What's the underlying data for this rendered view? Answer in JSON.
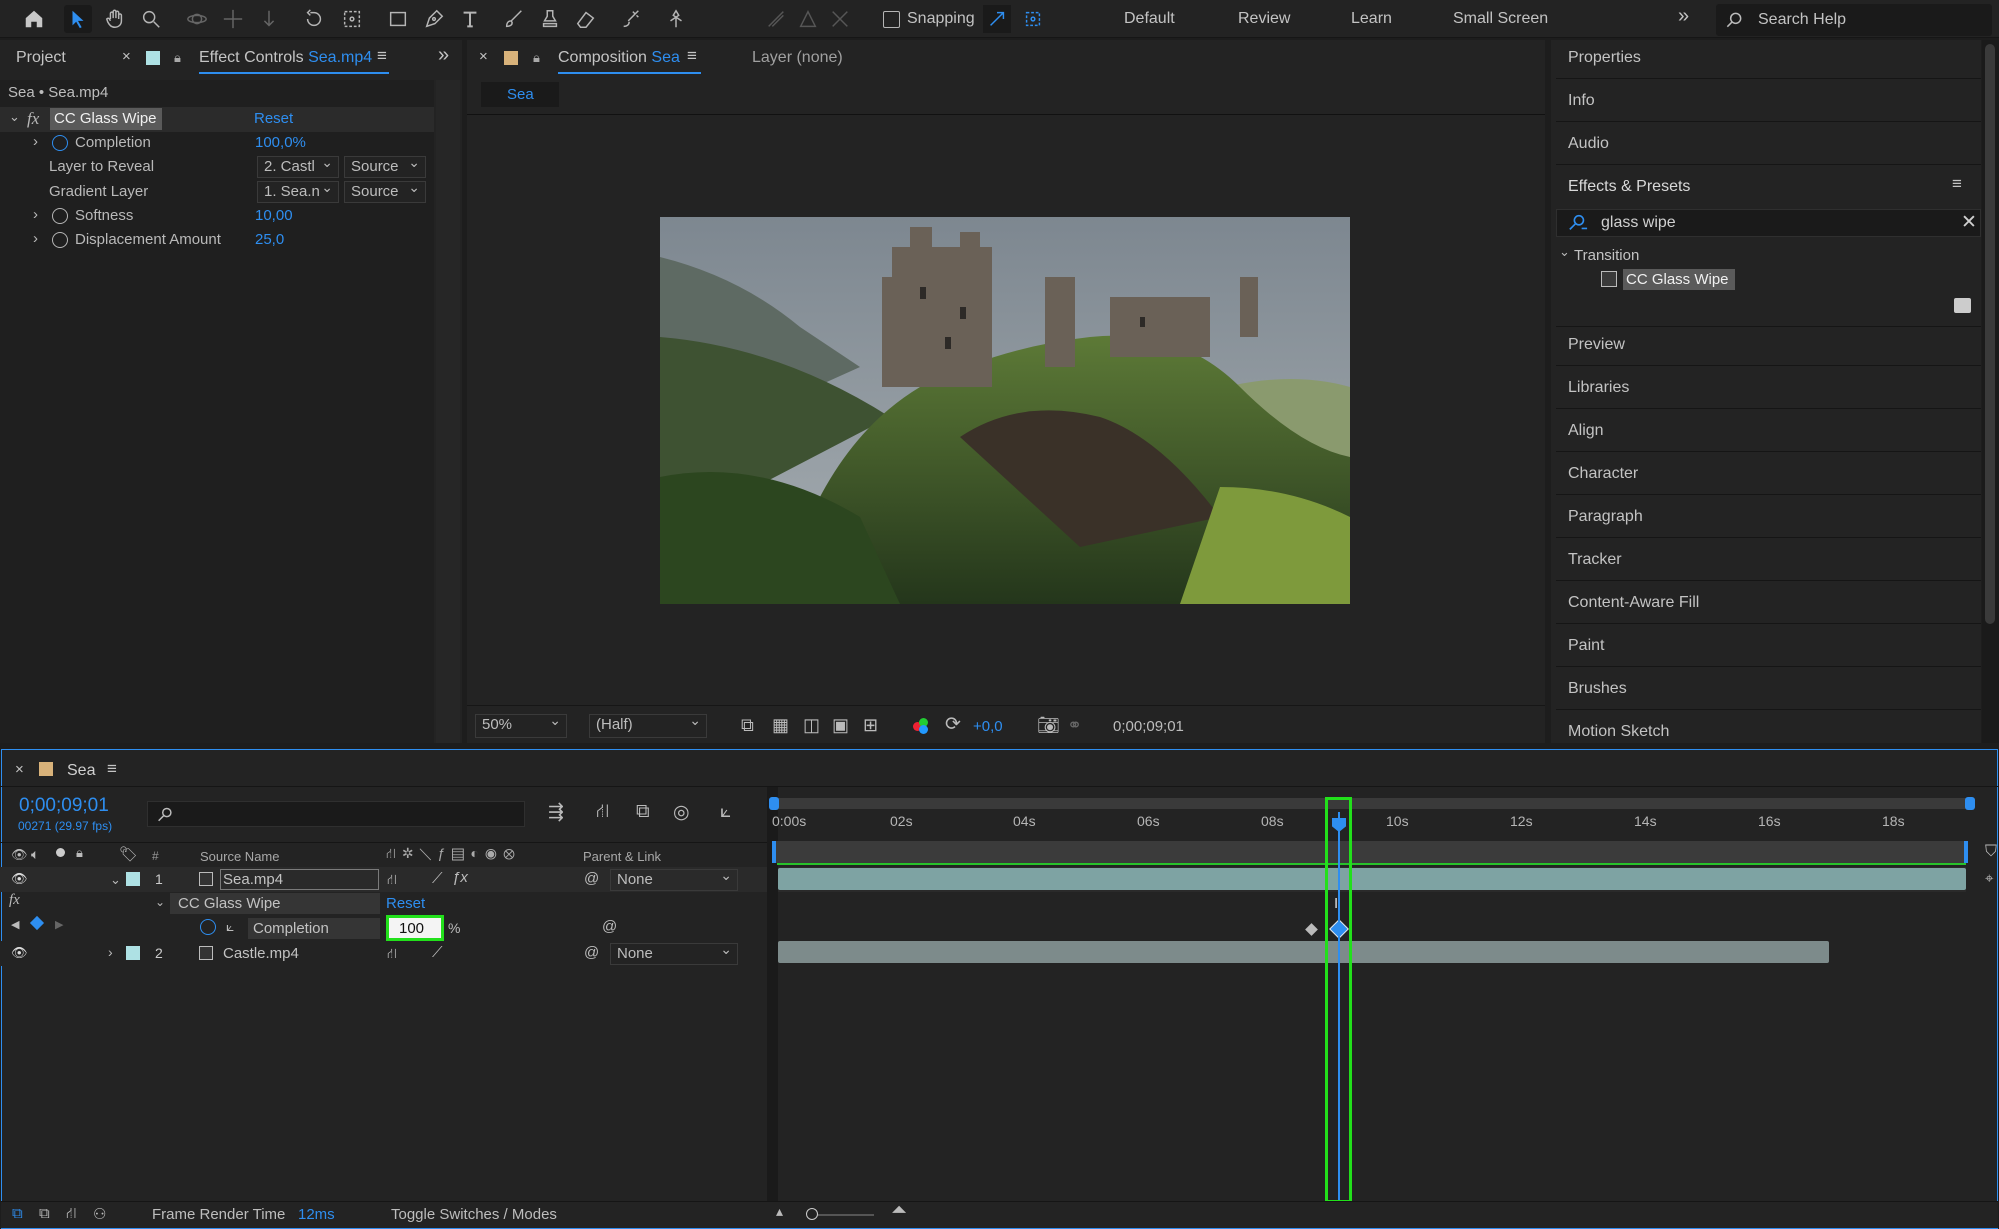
{
  "toolbar": {
    "snapping_label": "Snapping",
    "workspaces": [
      "Default",
      "Review",
      "Learn",
      "Small Screen"
    ],
    "search_help_placeholder": "Search Help"
  },
  "left_panel": {
    "tab_project": "Project",
    "tab_effect_controls": "Effect Controls",
    "tab_effect_controls_layer": "Sea.mp4",
    "context": "Sea • Sea.mp4",
    "effect_name": "CC Glass Wipe",
    "effect_reset": "Reset",
    "properties": [
      {
        "label": "Completion",
        "value": "100,0%"
      },
      {
        "label": "Layer to Reveal",
        "value": "2. Castl",
        "source": "Source"
      },
      {
        "label": "Gradient Layer",
        "value": "1. Sea.n",
        "source": "Source"
      },
      {
        "label": "Softness",
        "value": "10,00"
      },
      {
        "label": "Displacement Amount",
        "value": "25,0"
      }
    ]
  },
  "comp_panel": {
    "tab_label": "Composition",
    "tab_comp": "Sea",
    "layer_tab": "Layer (none)",
    "subtab": "Sea",
    "zoom": "50%",
    "resolution": "(Half)",
    "exposure": "+0,0",
    "timecode": "0;00;09;01"
  },
  "right_panel": {
    "items_top": [
      "Properties",
      "Info",
      "Audio"
    ],
    "effects_title": "Effects & Presets",
    "search_value": "glass wipe",
    "folder": "Transition",
    "result": "CC Glass Wipe",
    "items_bottom": [
      "Preview",
      "Libraries",
      "Align",
      "Character",
      "Paragraph",
      "Tracker",
      "Content-Aware Fill",
      "Paint",
      "Brushes",
      "Motion Sketch"
    ]
  },
  "timeline": {
    "comp_name": "Sea",
    "current_time": "0;00;09;01",
    "frame_info": "00271 (29.97 fps)",
    "col_num": "#",
    "col_source": "Source Name",
    "col_parent": "Parent & Link",
    "ruler": [
      "0:00s",
      "02s",
      "04s",
      "06s",
      "08s",
      "10s",
      "12s",
      "14s",
      "16s",
      "18s"
    ],
    "layers": [
      {
        "num": "1",
        "name": "Sea.mp4",
        "parent": "None"
      },
      {
        "num": "2",
        "name": "Castle.mp4",
        "parent": "None"
      }
    ],
    "effect_name": "CC Glass Wipe",
    "effect_reset": "Reset",
    "completion_label": "Completion",
    "completion_value": "100",
    "completion_unit": "%",
    "footer_render_label": "Frame Render Time",
    "footer_render_value": "12ms",
    "footer_toggle": "Toggle Switches / Modes"
  },
  "colors": {
    "accent": "#2e8ef0",
    "highlight_box": "#22e01b",
    "clip": "#7ea3a3",
    "label_swatch": "#aee1e4"
  }
}
